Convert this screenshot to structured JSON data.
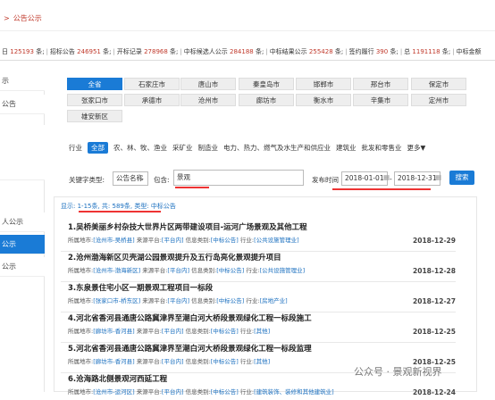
{
  "breadcrumb": {
    "sep": ">",
    "current": "公告公示"
  },
  "stats": [
    {
      "label": "日",
      "value": "125193",
      "unit": "条;"
    },
    {
      "label": "招标公告",
      "value": "246951",
      "unit": "条;"
    },
    {
      "label": "开标记录",
      "value": "278968",
      "unit": "条;"
    },
    {
      "label": "中标候选人公示",
      "value": "284188",
      "unit": "条;"
    },
    {
      "label": "中标结果公示",
      "value": "255428",
      "unit": "条;"
    },
    {
      "label": "签约履行",
      "value": "390",
      "unit": "条;"
    },
    {
      "label": "总",
      "value": "1191118",
      "unit": "条;"
    },
    {
      "label": "中标金额",
      "value": "",
      "unit": ""
    }
  ],
  "sidebar": [
    {
      "label": "示",
      "active": false
    },
    {
      "label": "公告",
      "active": false
    },
    {
      "label": "",
      "active": false
    },
    {
      "label": "",
      "active": false
    },
    {
      "label": "",
      "active": false
    },
    {
      "label": "人公示",
      "active": false
    },
    {
      "label": "公示",
      "active": true
    },
    {
      "label": "公示",
      "active": false
    }
  ],
  "cities": [
    "全省",
    "石家庄市",
    "唐山市",
    "秦皇岛市",
    "邯郸市",
    "邢台市",
    "保定市",
    "张家口市",
    "承德市",
    "沧州市",
    "廊坊市",
    "衡水市",
    "辛集市",
    "定州市",
    "雄安新区"
  ],
  "industry": {
    "label": "行业",
    "selected": "全部",
    "items": [
      "农、林、牧、渔业",
      "采矿业",
      "制造业",
      "电力、热力、燃气及水生产和供应业",
      "建筑业",
      "批发和零售业"
    ],
    "more": "更多▼"
  },
  "search": {
    "keyword_type_label": "关键字类型:",
    "keyword_type_value": "公告名称",
    "contains_label": "包含:",
    "contains_value": "景观",
    "date_label": "发布时间",
    "date_from": "2018-01-01",
    "date_to": "2018-12-31",
    "date_sep": "-",
    "search_btn": "搜索"
  },
  "result_info": "显示: 1-15条, 共: 589条, 类型: 中标公告",
  "results": [
    {
      "title": "1.吴桥美丽乡村杂技大世界片区两带建设项目-运河广场景观及其他工程",
      "city": "[沧州市-吴桥县]",
      "source": "[平台内]",
      "info_type": "[中标公告]",
      "industry": "[公共设施管理业]",
      "date": "2018-12-29"
    },
    {
      "title": "2.沧州渤海新区贝壳湖公园景观提升及五行岛亮化景观提升项目",
      "city": "[沧州市-渤海新区]",
      "source": "[平台内]",
      "info_type": "[中标公告]",
      "industry": "[公共设施管理业]",
      "date": "2018-12-28"
    },
    {
      "title": "3.东泉景住宅小区一期景观工程项目一标段",
      "city": "[张家口市-桥东区]",
      "source": "[平台内]",
      "info_type": "[中标公告]",
      "industry": "[房地产业]",
      "date": "2018-12-27"
    },
    {
      "title": "4.河北省香河县通唐公路冀津界至潮白河大桥段景观绿化工程一标段施工",
      "city": "[廊坊市-香河县]",
      "source": "[平台内]",
      "info_type": "[中标公告]",
      "industry": "[其他]",
      "date": "2018-12-25"
    },
    {
      "title": "5.河北省香河县通唐公路冀津界至潮白河大桥段景观绿化工程一标段监理",
      "city": "[廊坊市-香河县]",
      "source": "[平台内]",
      "info_type": "[中标公告]",
      "industry": "[其他]",
      "date": "2018-12-25"
    },
    {
      "title": "6.沧海路北侧景观河西延工程",
      "city": "[沧州市-运河区]",
      "source": "[平台内]",
      "info_type": "[中标公告]",
      "industry": "[建筑装饰、装修和其他建筑业]",
      "date": "2018-12-24"
    }
  ],
  "meta_labels": {
    "city": "所属地市:",
    "source": "来源平台:",
    "info_type": "信息类别:",
    "industry": "行业:"
  },
  "watermark": "公众号 · 景观新视界"
}
